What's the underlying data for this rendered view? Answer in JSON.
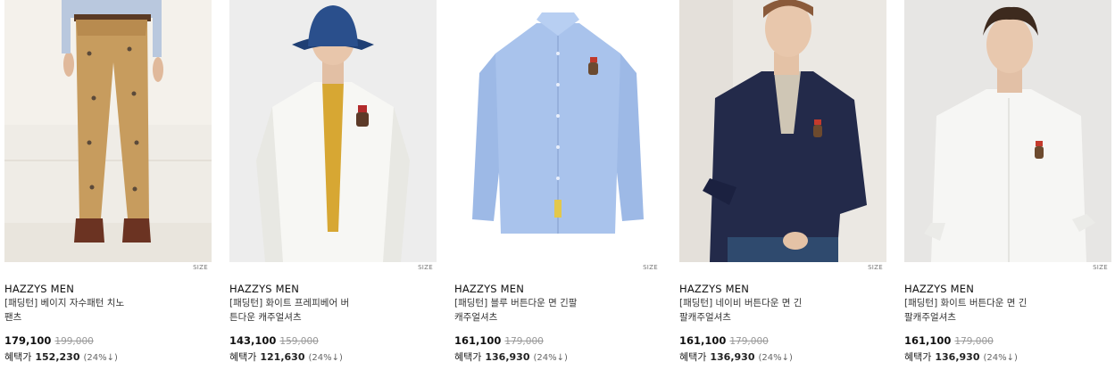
{
  "products": [
    {
      "brand": "HAZZYS MEN",
      "name_line1": "[패딩턴] 베이지 자수패턴 치노",
      "name_line2": "팬츠",
      "price": "179,100",
      "original_price": "199,000",
      "benefit_label": "혜택가",
      "benefit_price": "152,230",
      "benefit_rate": "(24%↓)",
      "size_label": "SIZE",
      "image": "beige-chino-pants-model-photo"
    },
    {
      "brand": "HAZZYS MEN",
      "name_line1": "[패딩턴] 화이트 프레피베어 버",
      "name_line2": "튼다운 캐주얼셔츠",
      "price": "143,100",
      "original_price": "159,000",
      "benefit_label": "혜택가",
      "benefit_price": "121,630",
      "benefit_rate": "(24%↓)",
      "size_label": "SIZE",
      "image": "white-shirt-bucket-hat-model-photo"
    },
    {
      "brand": "HAZZYS MEN",
      "name_line1": "[패딩턴] 블루 버튼다운 면 긴팔",
      "name_line2": "캐주얼셔츠",
      "price": "161,100",
      "original_price": "179,000",
      "benefit_label": "혜택가",
      "benefit_price": "136,930",
      "benefit_rate": "(24%↓)",
      "size_label": "SIZE",
      "image": "blue-shirt-product-photo"
    },
    {
      "brand": "HAZZYS MEN",
      "name_line1": "[패딩턴] 네이비 버튼다운 면 긴",
      "name_line2": "팔캐주얼셔츠",
      "price": "161,100",
      "original_price": "179,000",
      "benefit_label": "혜택가",
      "benefit_price": "136,930",
      "benefit_rate": "(24%↓)",
      "size_label": "SIZE",
      "image": "navy-shirt-model-photo"
    },
    {
      "brand": "HAZZYS MEN",
      "name_line1": "[패딩턴] 화이트 버튼다운 면 긴",
      "name_line2": "팔캐주얼셔츠",
      "price": "161,100",
      "original_price": "179,000",
      "benefit_label": "혜택가",
      "benefit_price": "136,930",
      "benefit_rate": "(24%↓)",
      "size_label": "SIZE",
      "image": "white-shirt-model-photo"
    }
  ]
}
